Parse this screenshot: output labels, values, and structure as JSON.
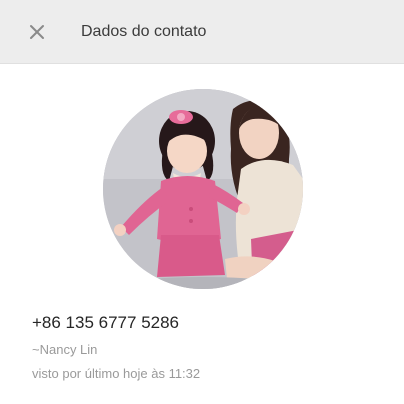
{
  "header": {
    "title": "Dados do contato",
    "close_icon": "close-icon"
  },
  "contact": {
    "phone": "+86 135 6777 5286",
    "push_name": "~Nancy Lin",
    "last_seen": "visto por último hoje às 11:32"
  },
  "colors": {
    "header_bg": "#ededed",
    "panel_bg": "#ffffff",
    "primary_text": "#262626",
    "secondary_text": "#9a9a9a"
  }
}
